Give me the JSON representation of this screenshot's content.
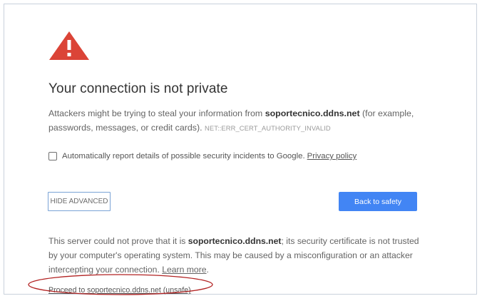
{
  "page": {
    "heading": "Your connection is not private",
    "desc_part1": "Attackers might be trying to steal your information from ",
    "domain": "soportecnico.ddns.net",
    "desc_part2": " (for example, passwords, messages, or credit cards). ",
    "error_code": "NET::ERR_CERT_AUTHORITY_INVALID",
    "report_label": "Automatically report details of possible security incidents to Google.",
    "privacy_link": "Privacy policy",
    "hide_advanced": "HIDE ADVANCED",
    "back_to_safety": "Back to safety",
    "detail_part1": "This server could not prove that it is ",
    "detail_part2": "; its security certificate is not trusted by your computer's operating system. This may be caused by a misconfiguration or an attacker intercepting your connection. ",
    "learn_more": "Learn more",
    "detail_end": ".",
    "proceed_link": "Proceed to soportecnico.ddns.net (unsafe)"
  },
  "colors": {
    "warning_red": "#db4437",
    "primary_button": "#4285f4",
    "annotation_oval": "#b22222"
  },
  "icons": {
    "warning": "warning-triangle-icon"
  }
}
